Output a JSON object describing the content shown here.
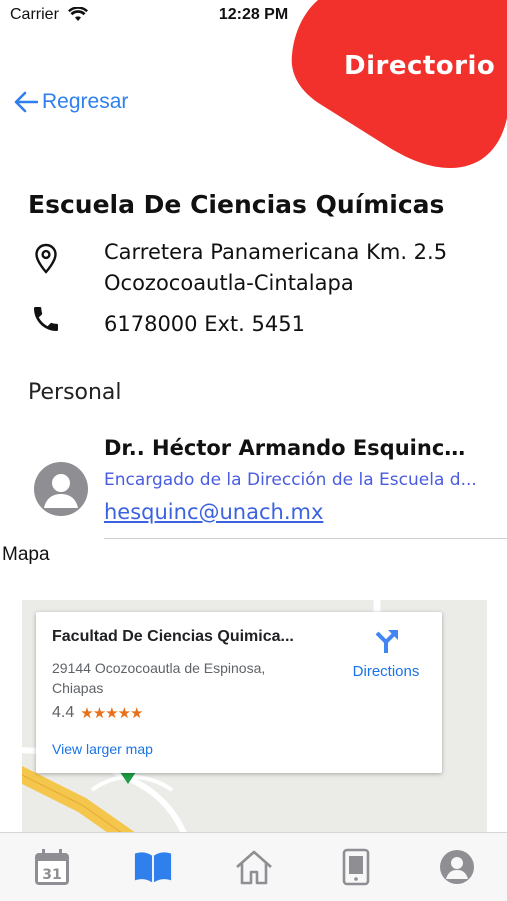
{
  "status_bar": {
    "carrier": "Carrier",
    "time": "12:28 PM"
  },
  "header": {
    "title": "Directorio",
    "back_label": "Regresar",
    "accent": "#f2302c"
  },
  "school": {
    "name": "Escuela De Ciencias Químicas",
    "address_line1": "Carretera Panamericana Km. 2.5",
    "address_line2": "Ocozocoautla-Cintalapa",
    "phone": "6178000 Ext. 5451"
  },
  "personal": {
    "heading": "Personal",
    "people": [
      {
        "name": "Dr.. Héctor Armando Esquinca A...",
        "role": "Encargado de la Dirección de la Escuela d...",
        "email": "hesquinc@unach.mx"
      }
    ]
  },
  "map": {
    "heading": "Mapa",
    "place_name": "Facultad De Ciencias Quimica...",
    "address_line1": "29144 Ocozocoautla de Espinosa,",
    "address_line2": "Chiapas",
    "rating": "4.4",
    "stars": "★★★★★",
    "larger_map_label": "View larger map",
    "directions_label": "Directions"
  },
  "tabbar": {
    "items": [
      {
        "icon": "calendar-icon",
        "label": "31"
      },
      {
        "icon": "book-icon",
        "active": true
      },
      {
        "icon": "home-icon"
      },
      {
        "icon": "phone-icon"
      },
      {
        "icon": "profile-icon"
      }
    ],
    "active_color": "#2f80ed",
    "inactive_color": "#8e8e93"
  }
}
